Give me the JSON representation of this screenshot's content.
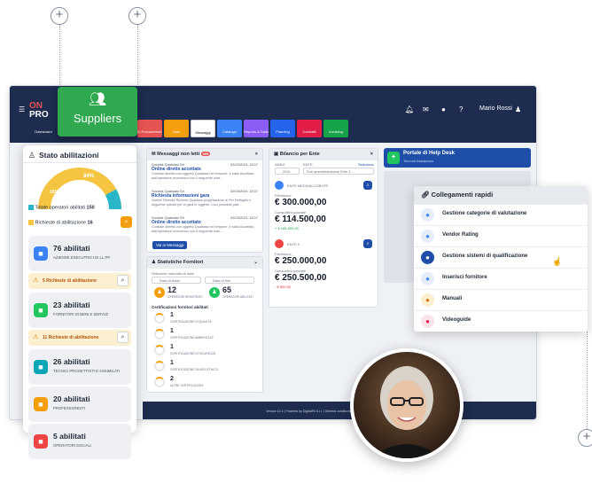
{
  "topbar": {
    "logo_line1": "ON",
    "logo_line2": "PRO",
    "user_name": "Mario Rossi",
    "modules": [
      {
        "label": "Dashboard",
        "color": "#1d2c4f"
      },
      {
        "label": "",
        "color": "#1d2c4f"
      },
      {
        "label": "",
        "color": "#1d2c4f"
      },
      {
        "label": "",
        "color": "#1d2c4f"
      },
      {
        "label": "E-Procurement",
        "color": "#e55353"
      },
      {
        "label": "Gare",
        "color": "#f59e0b"
      },
      {
        "label": "Messaggi",
        "color": "#ffffff"
      },
      {
        "label": "Catalogo",
        "color": "#3b82f6"
      },
      {
        "label": "Reports & Stats",
        "color": "#8b5cf6"
      },
      {
        "label": "Planning",
        "color": "#2563eb"
      },
      {
        "label": "Contratti",
        "color": "#e11d48"
      },
      {
        "label": "Invoicing",
        "color": "#16a34a"
      }
    ]
  },
  "suppliers_badge": {
    "label": "Suppliers",
    "icon": "users-icon"
  },
  "stato": {
    "title": "Stato abilitazioni",
    "gauge_percent_label": "84%",
    "gauge_small_label": "16%",
    "gauge_value": 84,
    "totale_label": "Totale operatori abilitati",
    "totale_value": "150",
    "richieste_label": "Richieste di abilitazione",
    "richieste_value": "16",
    "cards": [
      {
        "num": "76 abilitati",
        "sub": "AZIENDE ESECUTRICI DI LL.PP",
        "color": "#3b82f6",
        "icon": "building-icon",
        "warn": "5 Richieste di abilitazione"
      },
      {
        "num": "23 abilitati",
        "sub": "FORNITORI DI BENI E SERVIZI",
        "color": "#22c55e",
        "icon": "truck-icon",
        "warn": "11 Richieste di abilitazione"
      },
      {
        "num": "26 abilitati",
        "sub": "TECNICI PROGETTISTI E ASSIMILATI",
        "color": "#0ea5b7",
        "icon": "tools-icon",
        "warn": ""
      },
      {
        "num": "20 abilitati",
        "sub": "PROFESSIONISTI",
        "color": "#f59e0b",
        "icon": "briefcase-icon",
        "warn": ""
      },
      {
        "num": "5 abilitati",
        "sub": "OPERATORI SOCIALI",
        "color": "#ef4444",
        "icon": "heart-hand-icon",
        "warn": ""
      }
    ]
  },
  "messages": {
    "title": "Messaggi non letti",
    "badge": "999",
    "items": [
      {
        "sender": "Società Qualsiasi Srl",
        "date": "02/03/2021 13:07",
        "title": "Online diretto accettato",
        "body": "Cordiale direttto con oggetto Qualsiasi nel tempore, è stato Accettato dall'operatore economico con il seguente note..."
      },
      {
        "sender": "Società Qualsiasi Srl",
        "date": "02/03/2021 13:07",
        "title": "Richiesta informazioni gara",
        "body": "Gentile Ricevite Ricevuti Qualsiasi progettazione di Per Dettaglio è seguente questo per la gara in oggetto. Così possibile part..."
      },
      {
        "sender": "Società Qualsiasi Srl",
        "date": "02/03/2021 13:07",
        "title": "Online diretto accettato",
        "body": "Cordiale direttto con oggetto Qualsiasi nel tempore, è stato Accettato dall'operatore economico con il seguente note..."
      }
    ],
    "button": "Vai ai Messaggi"
  },
  "stats": {
    "title": "Statistiche Fornitori",
    "subtitle": "Selezione intervallo di date",
    "from_placeholder": "Data di inizio",
    "to_placeholder": "Data di fine",
    "kpi": [
      {
        "value": "12",
        "label": "OPERATORI REGISTRATI",
        "color": "#f59e0b"
      },
      {
        "value": "65",
        "label": "OPERATORI ABILITATI",
        "color": "#22c55e"
      }
    ],
    "cert_title": "Certificazioni fornitori abilitati",
    "certs": [
      {
        "value": "1",
        "label": "CERTIFICAZIONE DI QUALITÀ"
      },
      {
        "value": "1",
        "label": "CERTIFICAZIONE AMBIENTALE"
      },
      {
        "value": "1",
        "label": "CERTIFICAZIONE DI SICUREZZA"
      },
      {
        "value": "1",
        "label": "CERTIFICAZIONE SA 8000 ETHICS"
      },
      {
        "value": "2",
        "label": "ALTRE CERTIFICAZIONI"
      }
    ]
  },
  "bilancio": {
    "title": "Bilancio per Ente",
    "year_label": "ANNO",
    "year_value": "2021",
    "ente_label": "ENTE",
    "ente_value": "Enti amministrazione Ente 1",
    "ente_link": "Seleziona",
    "blocks": [
      {
        "name": "ENTE MEDIOALCOBOFF",
        "prev_label": "Previsione",
        "prev": "€ 300.000,00",
        "cons_label": "Consuntivo parziale",
        "cons": "€ 114.500,00",
        "delta": "+ € 185.500,00",
        "delta_color": "#16a34a",
        "color": "#3b82f6"
      },
      {
        "name": "ENTE X",
        "prev_label": "Previsione",
        "prev": "€ 250.000,00",
        "cons_label": "Consuntivo parziale",
        "cons": "€ 250.500,00",
        "delta": "- € 500,00",
        "delta_color": "#dc2626",
        "color": "#ef4444"
      }
    ]
  },
  "helpdesk": {
    "title": "Portale di Help Desk",
    "subtitle": "Tecnodi Assistenza"
  },
  "footer": {
    "text": "Version 10.1 | Powered by DigitalPA S.r.l. | General conditions and license | all-requirement bugs © DigitalPA"
  },
  "collegamenti": {
    "title": "Collegamenti rapidi",
    "items": [
      {
        "label": "Gestione categorie di valutazione",
        "icon": "list-icon",
        "color": "#3b82f6",
        "bg": "#e5edfb"
      },
      {
        "label": "Vendor Rating",
        "icon": "star-icon",
        "color": "#3b82f6",
        "bg": "#e5edfb"
      },
      {
        "label": "Gestione sistemi di qualificazione",
        "icon": "qualification-icon",
        "color": "#ffffff",
        "bg": "#1e4ea8"
      },
      {
        "label": "Inserisci fornitore",
        "icon": "add-user-icon",
        "color": "#3b82f6",
        "bg": "#e5edfb"
      },
      {
        "label": "Manuali",
        "icon": "book-icon",
        "color": "#d97706",
        "bg": "#fcefd0"
      },
      {
        "label": "Videoguide",
        "icon": "video-icon",
        "color": "#e11d48",
        "bg": "#fde2e7"
      }
    ]
  }
}
